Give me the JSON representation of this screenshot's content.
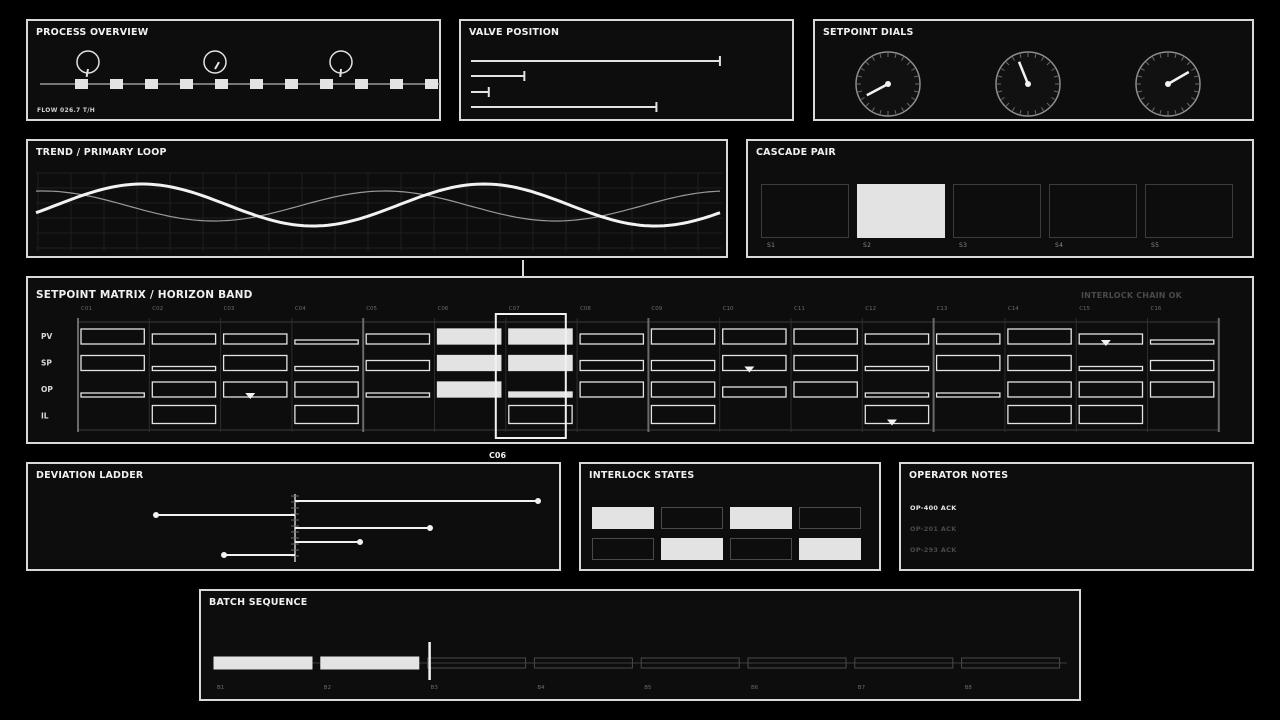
{
  "process_overview": {
    "title": "PROCESS OVERVIEW",
    "flow_label": "FLOW 026.7 T/H",
    "gauges": [
      {
        "name": "gauge-1",
        "needle_deg": 190
      },
      {
        "name": "gauge-2",
        "needle_deg": 30
      },
      {
        "name": "gauge-3",
        "needle_deg": 185
      }
    ],
    "blocks": 11
  },
  "valve_position": {
    "title": "VALVE POSITION",
    "valves": [
      0.98,
      0.21,
      0.07,
      0.73
    ]
  },
  "setpoint_dials": {
    "title": "SETPOINT DIALS",
    "dials": [
      {
        "needle_deg": 242
      },
      {
        "needle_deg": 338
      },
      {
        "needle_deg": 60
      }
    ]
  },
  "trend": {
    "title": "TREND / PRIMARY LOOP"
  },
  "cascade": {
    "title": "CASCADE PAIR",
    "slots": [
      "S1",
      "S2",
      "S3",
      "S4",
      "S5"
    ],
    "active_slot": 1
  },
  "matrix": {
    "title": "SETPOINT MATRIX / HORIZON BAND",
    "status": "INTERLOCK CHAIN OK",
    "columns": [
      "C01",
      "C02",
      "C03",
      "C04",
      "C05",
      "C06",
      "C07",
      "C08",
      "C09",
      "C10",
      "C11",
      "C12",
      "C13",
      "C14",
      "C15",
      "C16"
    ],
    "rows": [
      "PV",
      "SP",
      "OP",
      "IL"
    ],
    "selected_column_label": "C06",
    "selected_column_index": 6
  },
  "deviation": {
    "title": "DEVIATION LADDER"
  },
  "interlock": {
    "title": "INTERLOCK STATES",
    "states": [
      [
        true,
        false,
        true,
        false
      ],
      [
        false,
        true,
        false,
        true
      ]
    ]
  },
  "notes": {
    "title": "OPERATOR NOTES",
    "entries": [
      {
        "text": "OP-400 ACK",
        "active": true
      },
      {
        "text": "OP-201 ACK",
        "active": false
      },
      {
        "text": "OP-293 ACK",
        "active": false
      }
    ]
  },
  "batch": {
    "title": "BATCH SEQUENCE",
    "steps": [
      "B1",
      "B2",
      "B3",
      "B4",
      "B5",
      "B6",
      "B7",
      "B8"
    ],
    "completed": 2
  },
  "colors": {
    "bg": "#000000",
    "panel": "#0c0d0c",
    "stroke": "#d9d9d9",
    "fill": "#e3e3e3",
    "dim": "#5a5a5a"
  }
}
